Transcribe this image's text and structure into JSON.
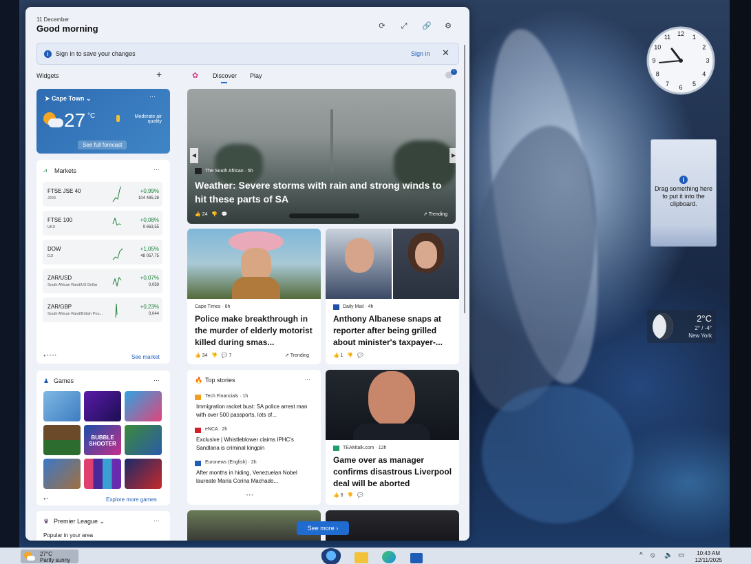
{
  "desktop": {
    "clock_numbers": [
      "12",
      "1",
      "2",
      "3",
      "4",
      "5",
      "6",
      "7",
      "8",
      "9",
      "10",
      "11"
    ],
    "clipboard_text": "Drag something here to put it into the clipboard.",
    "weather_gadget": {
      "temp": "2°C",
      "range": "2° / -4°",
      "city": "New York"
    }
  },
  "panel": {
    "date": "11 December",
    "greeting": "Good morning",
    "signin_bar": {
      "message": "Sign in to save your changes",
      "action": "Sign in"
    },
    "widgets_title": "Widgets",
    "add_symbol": "+",
    "tabs": [
      "Discover",
      "Play"
    ]
  },
  "weather": {
    "city": "Cape Town",
    "temp": "27",
    "unit": "°C",
    "air": "Moderate air quality",
    "forecast": "See full forecast",
    "menu": "···"
  },
  "markets": {
    "title": "Markets",
    "menu": "···",
    "link": "See market",
    "dots": "● • • • •",
    "rows": [
      {
        "name": "FTSE JSE 40",
        "sub": "J200",
        "pct": "+0,99%",
        "val": "104 485,28"
      },
      {
        "name": "FTSE 100",
        "sub": "UKX",
        "pct": "+0,08%",
        "val": "9 663,55"
      },
      {
        "name": "DOW",
        "sub": "DJI",
        "pct": "+1,05%",
        "val": "48 057,75"
      },
      {
        "name": "ZAR/USD",
        "sub": "South African Rand/US Dollar",
        "pct": "+0,07%",
        "val": "0,059"
      },
      {
        "name": "ZAR/GBP",
        "sub": "South African Rand/British Pou...",
        "pct": "+0,23%",
        "val": "0,044"
      }
    ]
  },
  "games": {
    "title": "Games",
    "menu": "···",
    "link": "Explore more games",
    "dots": "● •",
    "bubble": "BUBBLE SHOOTER"
  },
  "premier": {
    "title": "Premier League",
    "menu": "···",
    "sub": "Popular in your area"
  },
  "hero": {
    "source": "The South African · 5h",
    "title": "Weather: Severe storms with rain and strong winds to hit these parts of SA",
    "likes": "24",
    "trending": "Trending"
  },
  "story1": {
    "source": "Cape Times · 6h",
    "title": "Police make breakthrough in the murder of elderly motorist killed during smas...",
    "likes": "34",
    "comments": "7",
    "trending": "Trending"
  },
  "story2": {
    "source": "Daily Mail · 4h",
    "title": "Anthony Albanese snaps at reporter after being grilled about minister's taxpayer-...",
    "likes": "1"
  },
  "top": {
    "title": "Top stories",
    "menu": "···",
    "dots": "• • •",
    "items": [
      {
        "source": "Tech Financials · 1h",
        "title": "Immigration racket bust: SA police arrest man with over 500 passports, lots of..."
      },
      {
        "source": "eNCA · 2h",
        "title": "Exclusive | Whistleblower claims IPHC's Sandlana is criminal kingpin"
      },
      {
        "source": "Euronews (English) · 2h",
        "title": "After months in hiding, Venezuelan Nobel laureate María Corina Machado..."
      }
    ]
  },
  "story3": {
    "source": "TEAMtalk.com · 12h",
    "title": "Game over as manager confirms disastrous Liverpool deal will be aborted",
    "likes": "6"
  },
  "see_more": "See more",
  "taskbar": {
    "weather_temp": "27°C",
    "weather_desc": "Partly sunny",
    "time": "10:43 AM",
    "date": "12/11/2025"
  }
}
